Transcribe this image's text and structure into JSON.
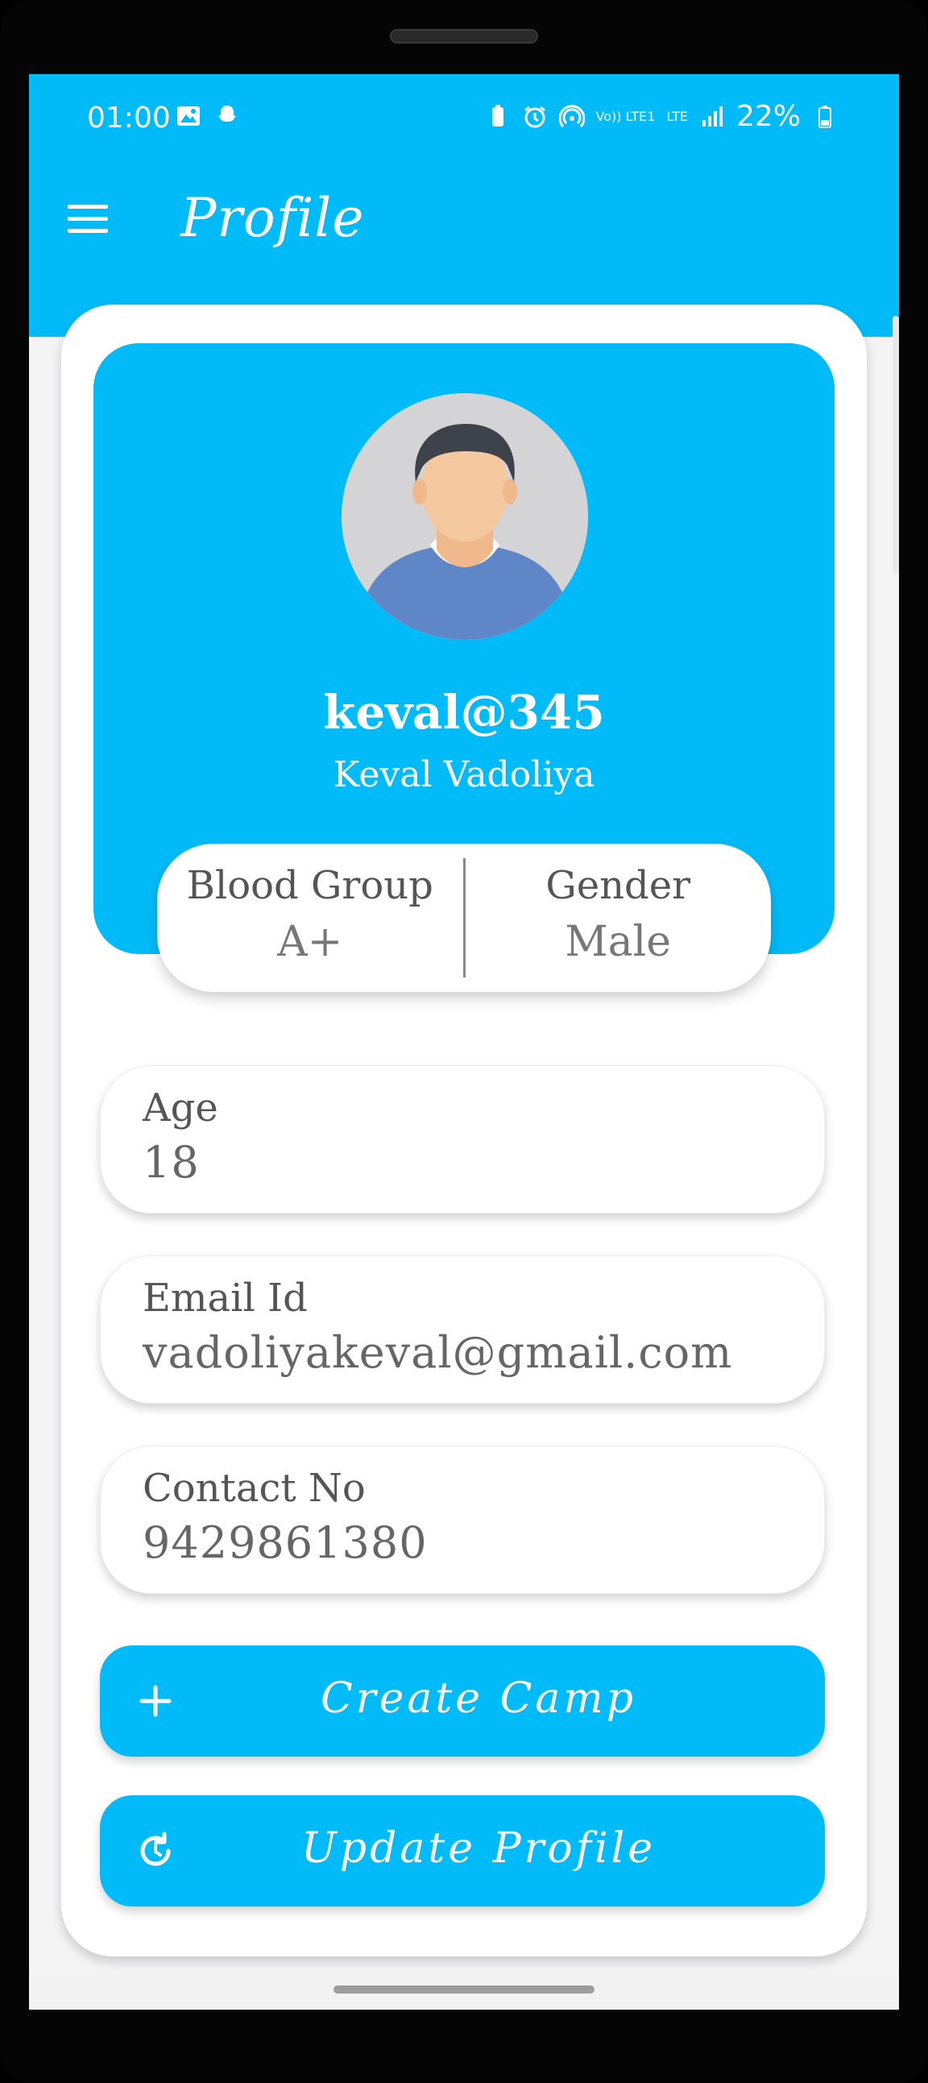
{
  "status_bar": {
    "time": "01:00",
    "battery": "22%",
    "network_label": "LTE",
    "volte_label": "Vo)) LTE1"
  },
  "app_bar": {
    "title": "Profile",
    "menu_icon": "hamburger-menu-icon"
  },
  "profile": {
    "username": "keval@345",
    "full_name": "Keval Vadoliya",
    "avatar_icon": "user-avatar-icon"
  },
  "stats": {
    "blood_group_label": "Blood Group",
    "blood_group_value": "A+",
    "gender_label": "Gender",
    "gender_value": "Male"
  },
  "fields": {
    "age_label": "Age",
    "age_value": "18",
    "email_label": "Email Id",
    "email_value": "vadoliyakeval@gmail.com",
    "contact_label": "Contact No",
    "contact_value": "9429861380"
  },
  "buttons": {
    "create_camp_label": "Create Camp",
    "create_camp_icon": "plus-icon",
    "update_profile_label": "Update Profile",
    "update_profile_icon": "refresh-clock-icon"
  },
  "colors": {
    "primary": "#00BBF8",
    "card": "#FFFFFF",
    "text_dark": "#555555"
  }
}
